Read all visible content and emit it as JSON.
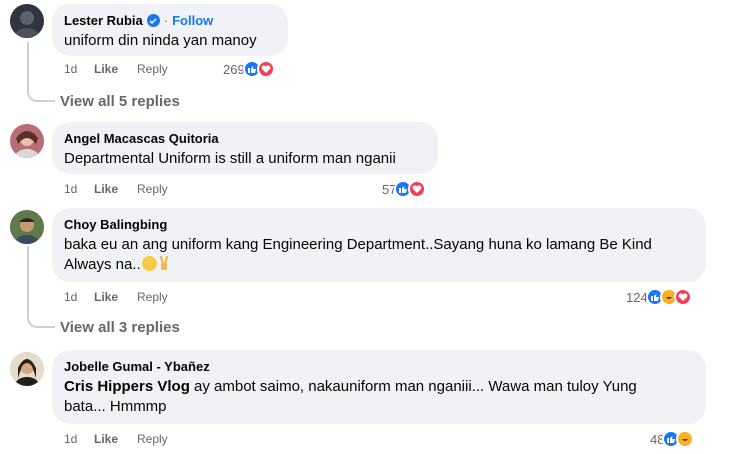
{
  "comments": [
    {
      "author": "Lester Rubia",
      "follow_label": "Follow",
      "separator": "·",
      "text": "uniform din ninda yan manoy",
      "time": "1d",
      "like_label": "Like",
      "reply_label": "Reply",
      "reaction_count": "269",
      "reactions": [
        "like-icon",
        "love-icon"
      ],
      "view_replies": "View all 5 replies"
    },
    {
      "author": "Angel Macascas Quitoria",
      "text": "Departmental Uniform is still a uniform man nganii",
      "time": "1d",
      "like_label": "Like",
      "reply_label": "Reply",
      "reaction_count": "57",
      "reactions": [
        "like-icon",
        "love-icon"
      ]
    },
    {
      "author": "Choy Balingbing",
      "text_line1": "baka eu an ang uniform kang Engineering Department..Sayang huna ko lamang Be Kind",
      "text_line2": "Always na..",
      "time": "1d",
      "like_label": "Like",
      "reply_label": "Reply",
      "reaction_count": "124",
      "reactions": [
        "like-icon",
        "haha-icon",
        "love-icon"
      ],
      "view_replies": "View all 3 replies"
    },
    {
      "author": "Jobelle Gumal - Ybañez",
      "mention": "Cris Hippers Vlog",
      "text_line1": " ay ambot saimo, nakauniform man nganiii... Wawa man tuloy Yung",
      "text_line2": "bata... Hmmmp",
      "time": "1d",
      "like_label": "Like",
      "reply_label": "Reply",
      "reaction_count": "48",
      "reactions": [
        "like-icon",
        "haha-icon"
      ]
    }
  ],
  "colors": {
    "bubble": "#f0f2f5",
    "link": "#1877f2",
    "muted": "#65676b",
    "like": "#1877f2",
    "love": "#f33e58",
    "haha": "#f7b125"
  }
}
